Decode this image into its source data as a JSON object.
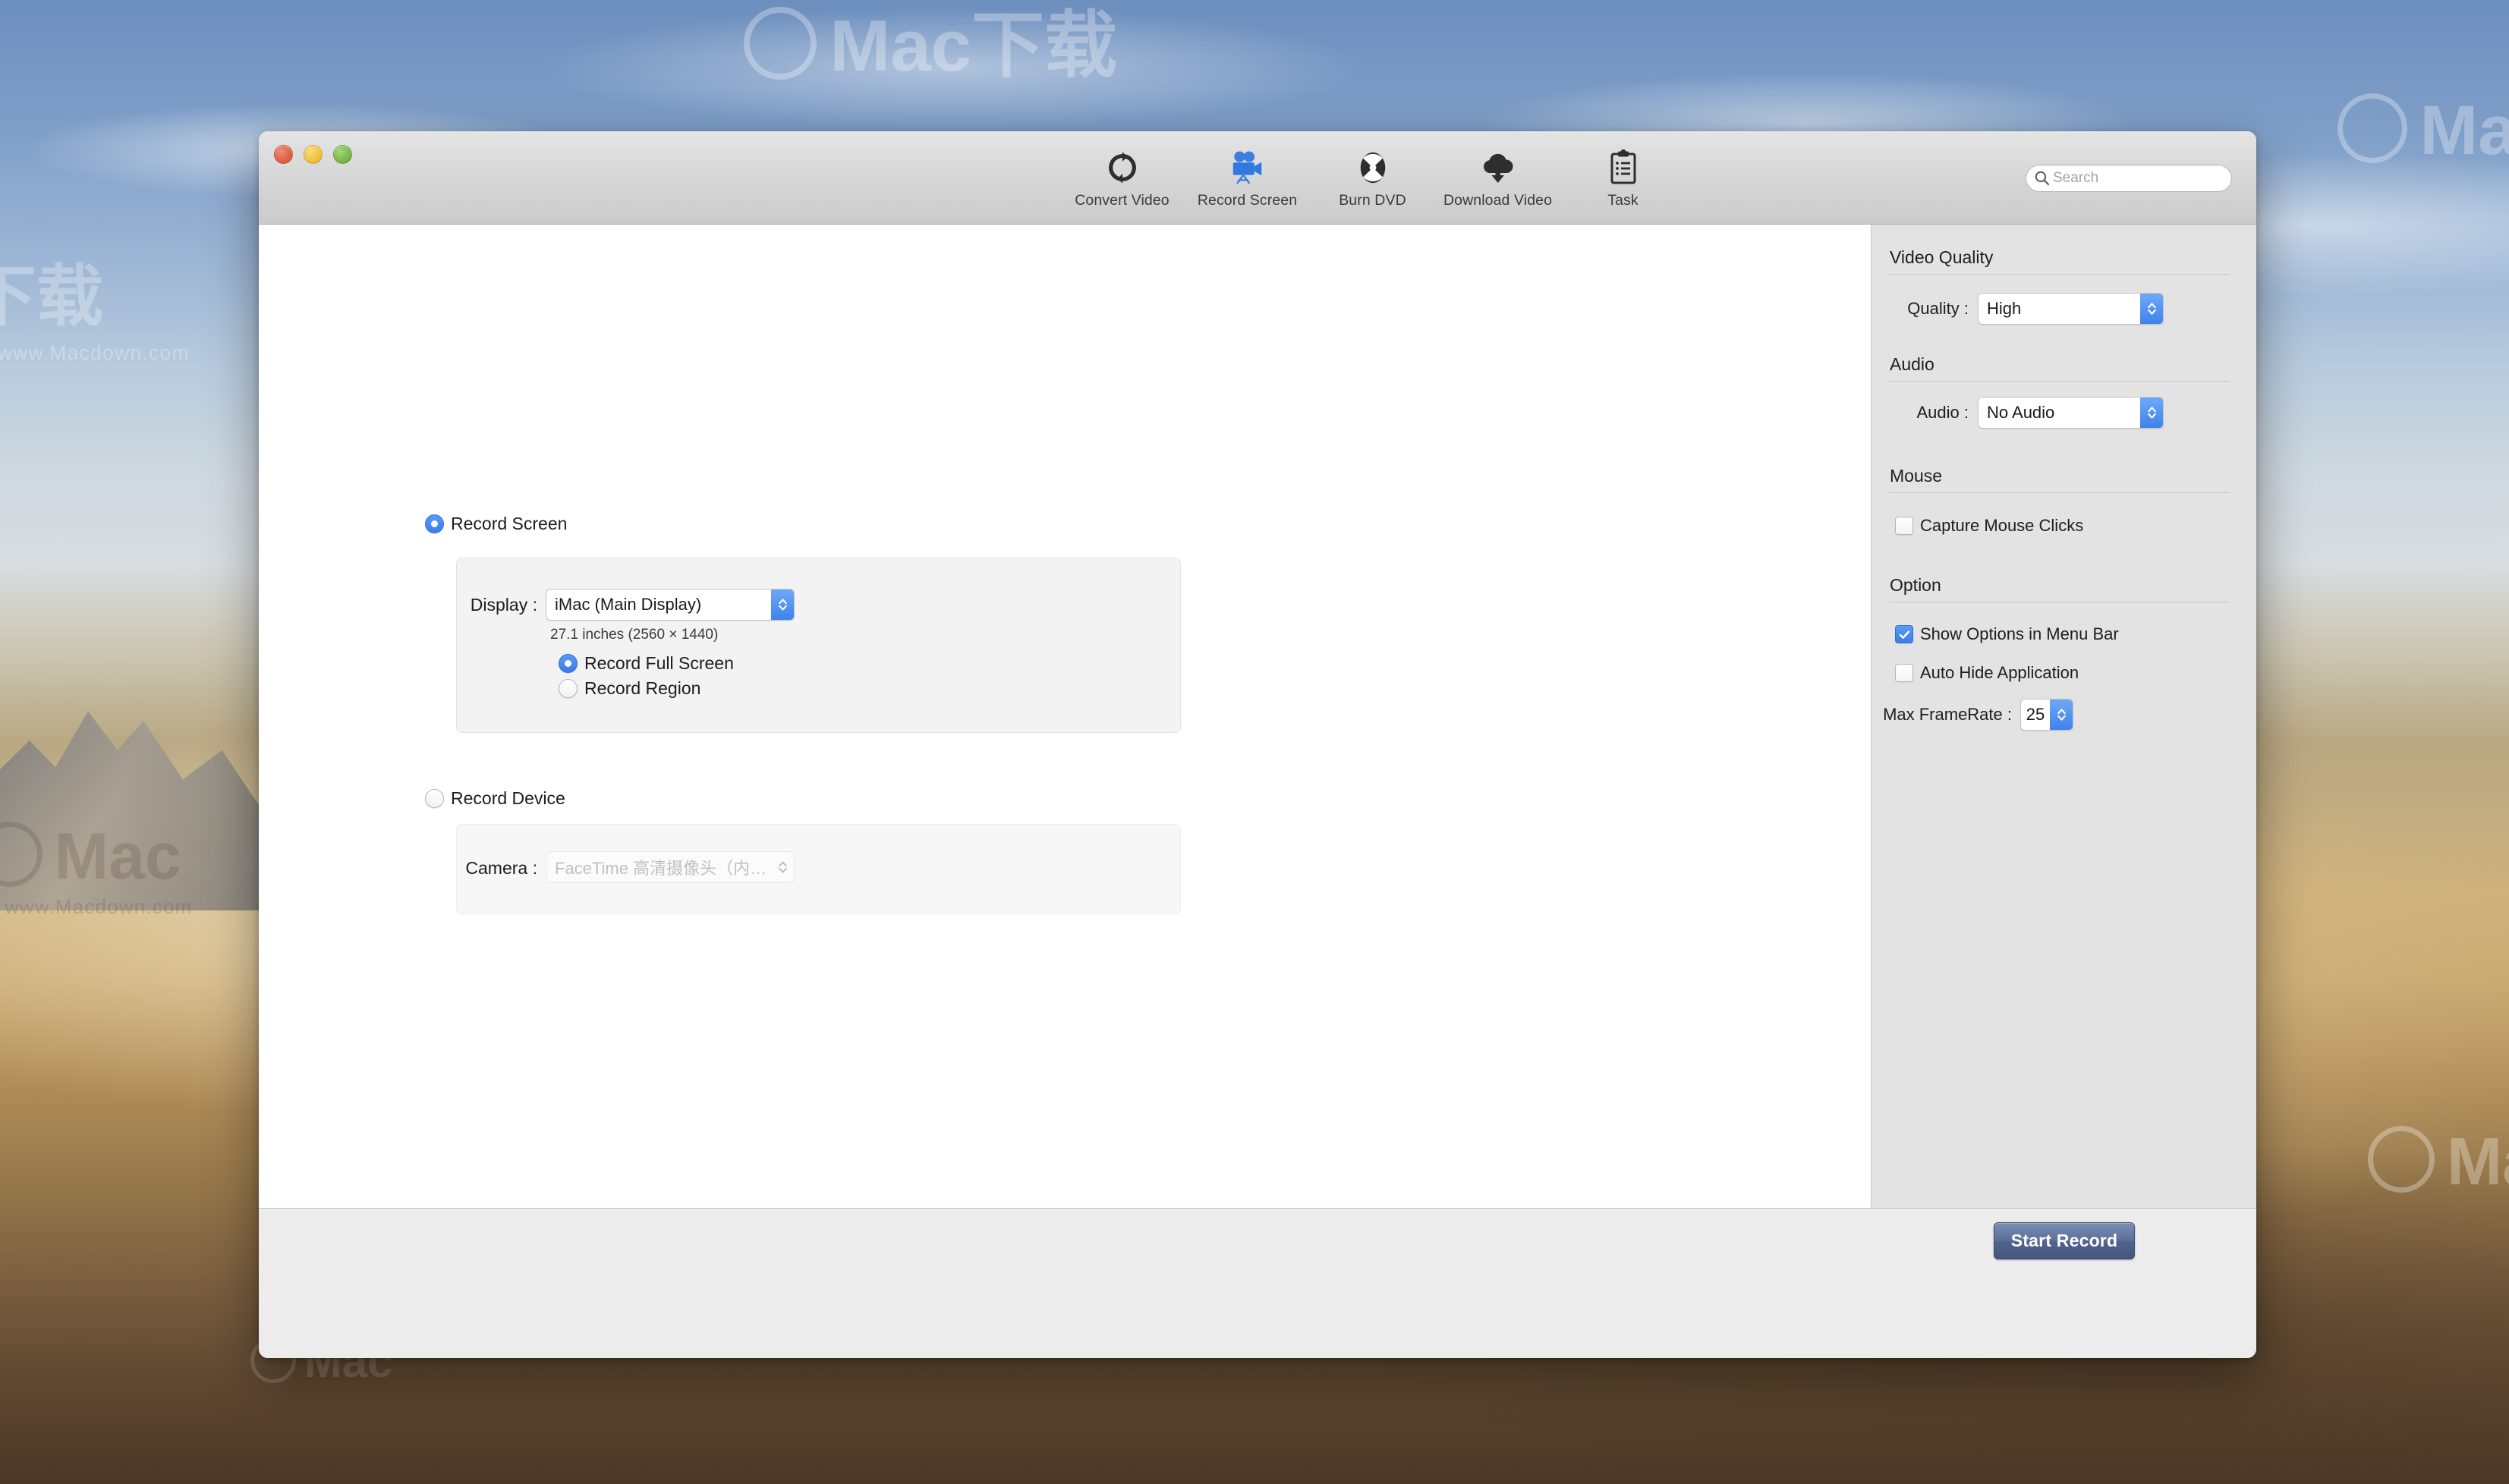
{
  "window": {
    "traffic_lights": [
      "close",
      "minimize",
      "zoom"
    ]
  },
  "toolbar": {
    "items": [
      {
        "label": "Convert Video",
        "icon": "convert-video-icon",
        "active": false
      },
      {
        "label": "Record Screen",
        "icon": "record-screen-icon",
        "active": true
      },
      {
        "label": "Burn DVD",
        "icon": "burn-dvd-icon",
        "active": false
      },
      {
        "label": "Download Video",
        "icon": "download-video-icon",
        "active": false
      },
      {
        "label": "Task",
        "icon": "task-icon",
        "active": false
      }
    ],
    "search": {
      "placeholder": "Search",
      "value": "",
      "icon": "search-icon"
    }
  },
  "main": {
    "record_screen": {
      "label": "Record Screen",
      "selected": true,
      "display_label": "Display :",
      "display_value": "iMac (Main Display)",
      "display_info": "27.1 inches (2560 × 1440)",
      "mode_options": [
        {
          "label": "Record Full Screen",
          "selected": true
        },
        {
          "label": "Record Region",
          "selected": false
        }
      ]
    },
    "record_device": {
      "label": "Record Device",
      "selected": false,
      "camera_label": "Camera :",
      "camera_value": "FaceTime 高清摄像头（内建）",
      "disabled": true
    }
  },
  "sidebar": {
    "sections": [
      {
        "title": "Video Quality",
        "field_label": "Quality :",
        "field_value": "High"
      },
      {
        "title": "Audio",
        "field_label": "Audio :",
        "field_value": "No Audio"
      },
      {
        "title": "Mouse",
        "checkbox_label": "Capture Mouse Clicks",
        "checked": false
      },
      {
        "title": "Option",
        "checkboxes": [
          {
            "label": "Show Options in Menu Bar",
            "checked": true
          },
          {
            "label": "Auto Hide Application",
            "checked": false
          }
        ],
        "framerate_label": "Max FrameRate :",
        "framerate_value": "25"
      }
    ]
  },
  "footer": {
    "start_button": "Start Record"
  },
  "watermarks": {
    "brand": "Mac",
    "brand_suffix": "下载",
    "site": "www.Macdown.com"
  },
  "colors": {
    "accent": "#3a7ce8",
    "toolbar_active": "#3d7ee0",
    "panel_bg": "#e3e3e3",
    "button_blue": "#5d7099"
  }
}
